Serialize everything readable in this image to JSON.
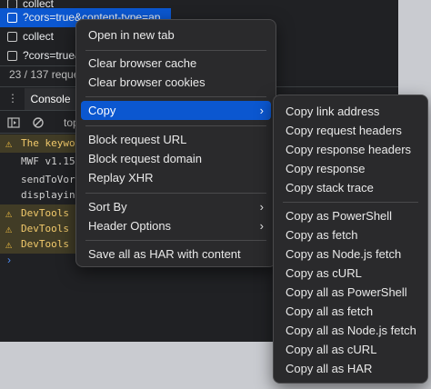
{
  "network": {
    "rows": [
      "collect",
      "?cors=true&content-type=ap",
      "collect",
      "?cors=true&"
    ],
    "summary": "23 / 137 reque"
  },
  "drawer": {
    "tab_label": "Console",
    "context_label": "top"
  },
  "console": {
    "lines": [
      {
        "type": "warn",
        "text": "The keywor"
      },
      {
        "type": "plain",
        "text": "MWF v1.15."
      },
      {
        "type": "plain",
        "text": "sendToVort"
      },
      {
        "type": "plain",
        "text": "displaying"
      },
      {
        "type": "warn",
        "text": "DevTools f"
      },
      {
        "type": "warn",
        "text": "DevTools f"
      },
      {
        "type": "warn",
        "text": "DevTools f"
      }
    ],
    "prompt": "›"
  },
  "context_menu": {
    "items": {
      "open_new_tab": "Open in new tab",
      "clear_cache": "Clear browser cache",
      "clear_cookies": "Clear browser cookies",
      "copy": "Copy",
      "block_url": "Block request URL",
      "block_domain": "Block request domain",
      "replay_xhr": "Replay XHR",
      "sort_by": "Sort By",
      "header_options": "Header Options",
      "save_har": "Save all as HAR with content"
    },
    "submenu_arrow": "›"
  },
  "copy_submenu": {
    "items": [
      "Copy link address",
      "Copy request headers",
      "Copy response headers",
      "Copy response",
      "Copy stack trace",
      "Copy as PowerShell",
      "Copy as fetch",
      "Copy as Node.js fetch",
      "Copy as cURL",
      "Copy all as PowerShell",
      "Copy all as fetch",
      "Copy all as Node.js fetch",
      "Copy all as cURL",
      "Copy all as HAR"
    ]
  },
  "colors": {
    "highlight": "#0b57d0",
    "menu_bg": "#2a2a2c",
    "warning": "#f5c242"
  }
}
